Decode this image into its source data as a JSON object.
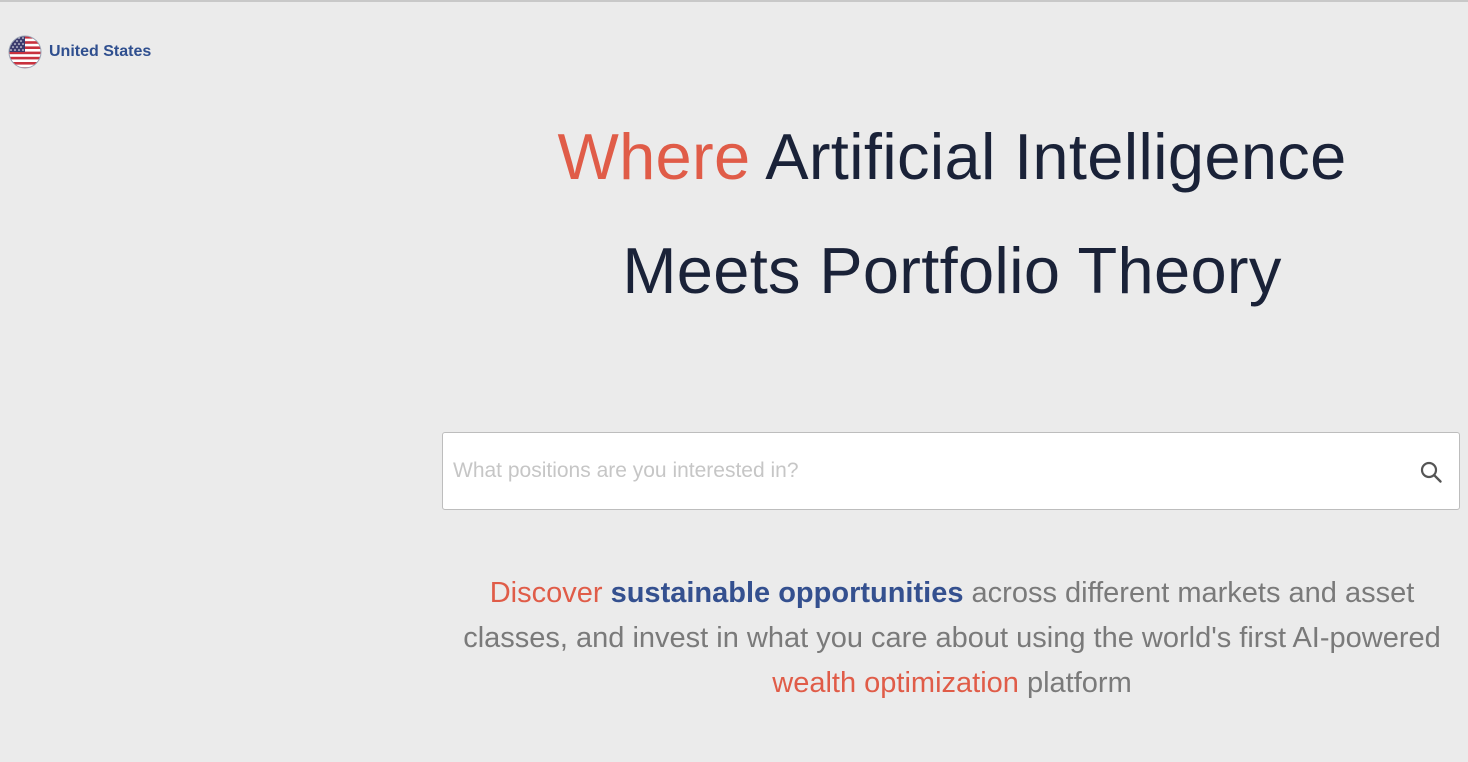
{
  "header": {
    "region": {
      "label": "United States",
      "icon": "us-flag-icon"
    }
  },
  "hero": {
    "accent_word": "Where",
    "line1_rest": "Artificial Intelligence",
    "line2": "Meets Portfolio Theory"
  },
  "search": {
    "placeholder": "What positions are you interested in?",
    "value": "",
    "icon": "search-icon"
  },
  "tagline": {
    "part1": "Discover",
    "part2": "sustainable opportunities",
    "part3": "across different markets and asset classes, and invest in what you care about using the world's first AI-powered",
    "part4": "wealth optimization",
    "part5": "platform"
  },
  "colors": {
    "background": "#ebebeb",
    "accent_orange": "#e05c48",
    "brand_blue": "#34508f",
    "heading_navy": "#1a2238",
    "body_gray": "#7a7a7a"
  }
}
